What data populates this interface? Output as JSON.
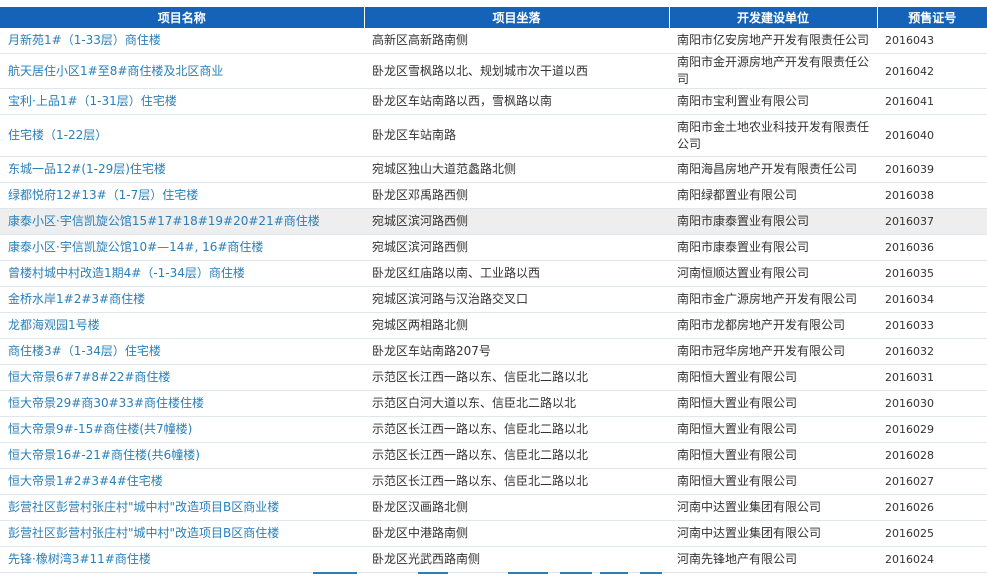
{
  "headers": [
    "项目名称",
    "项目坐落",
    "开发建设单位",
    "预售证号"
  ],
  "rows": [
    {
      "name": "月新苑1#（1-33层）商住楼",
      "location": "高新区高新路南侧",
      "developer": "南阳市亿安房地产开发有限责任公司",
      "permit": "2016043"
    },
    {
      "name": "航天居住小区1#至8#商住楼及北区商业",
      "location": "卧龙区雪枫路以北、规划城市次干道以西",
      "developer": "南阳市金开源房地产开发有限责任公司",
      "permit": "2016042"
    },
    {
      "name": "宝利·上品1#（1-31层）住宅楼",
      "location": "卧龙区车站南路以西，雪枫路以南",
      "developer": "南阳市宝利置业有限公司",
      "permit": "2016041"
    },
    {
      "name": "住宅楼（1-22层）",
      "location": "卧龙区车站南路",
      "developer": "南阳市金土地农业科技开发有限责任公司",
      "permit": "2016040"
    },
    {
      "name": "东城一品12#(1-29层)住宅楼",
      "location": "宛城区独山大道范蠡路北侧",
      "developer": "南阳海昌房地产开发有限责任公司",
      "permit": "2016039"
    },
    {
      "name": "绿都悦府12#13#（1-7层）住宅楼",
      "location": "卧龙区邓禹路西侧",
      "developer": "南阳绿都置业有限公司",
      "permit": "2016038"
    },
    {
      "name": "康泰小区·宇信凯旋公馆15#17#18#19#20#21#商住楼",
      "location": "宛城区滨河路西侧",
      "developer": "南阳市康泰置业有限公司",
      "permit": "2016037"
    },
    {
      "name": "康泰小区·宇信凯旋公馆10#—14#, 16#商住楼",
      "location": "宛城区滨河路西侧",
      "developer": "南阳市康泰置业有限公司",
      "permit": "2016036"
    },
    {
      "name": "曾楼村城中村改造1期4#（-1-34层）商住楼",
      "location": "卧龙区红庙路以南、工业路以西",
      "developer": "河南恒顺达置业有限公司",
      "permit": "2016035"
    },
    {
      "name": "金桥水岸1#2#3#商住楼",
      "location": "宛城区滨河路与汉治路交叉口",
      "developer": "南阳市金广源房地产开发有限公司",
      "permit": "2016034"
    },
    {
      "name": "龙都海观园1号楼",
      "location": "宛城区两相路北侧",
      "developer": "南阳市龙都房地产开发有限公司",
      "permit": "2016033"
    },
    {
      "name": "商住楼3#（1-34层）住宅楼",
      "location": "卧龙区车站南路207号",
      "developer": "南阳市冠华房地产开发有限公司",
      "permit": "2016032"
    },
    {
      "name": "恒大帝景6#7#8#22#商住楼",
      "location": "示范区长江西一路以东、信臣北二路以北",
      "developer": "南阳恒大置业有限公司",
      "permit": "2016031"
    },
    {
      "name": "恒大帝景29#商30#33#商住楼住楼",
      "location": "示范区白河大道以东、信臣北二路以北",
      "developer": "南阳恒大置业有限公司",
      "permit": "2016030"
    },
    {
      "name": "恒大帝景9#-15#商住楼(共7幢楼)",
      "location": "示范区长江西一路以东、信臣北二路以北",
      "developer": "南阳恒大置业有限公司",
      "permit": "2016029"
    },
    {
      "name": "恒大帝景16#-21#商住楼(共6幢楼)",
      "location": "示范区长江西一路以东、信臣北二路以北",
      "developer": "南阳恒大置业有限公司",
      "permit": "2016028"
    },
    {
      "name": "恒大帝景1#2#3#4#住宅楼",
      "location": "示范区长江西一路以东、信臣北二路以北",
      "developer": "南阳恒大置业有限公司",
      "permit": "2016027"
    },
    {
      "name": "彭营社区彭营村张庄村\"城中村\"改造项目B区商业楼",
      "location": "卧龙区汉画路北侧",
      "developer": "河南中达置业集团有限公司",
      "permit": "2016026"
    },
    {
      "name": "彭营社区彭营村张庄村\"城中村\"改造项目B区商住楼",
      "location": "卧龙区中港路南侧",
      "developer": "河南中达置业集团有限公司",
      "permit": "2016025"
    },
    {
      "name": "先锋·橡树湾3#11#商住楼",
      "location": "卧龙区光武西路南侧",
      "developer": "河南先锋地产有限公司",
      "permit": "2016024"
    }
  ],
  "colors": {
    "header_bg": "#1463b8",
    "link": "#2a7fb8",
    "highlight_row": "#eeeeee"
  }
}
